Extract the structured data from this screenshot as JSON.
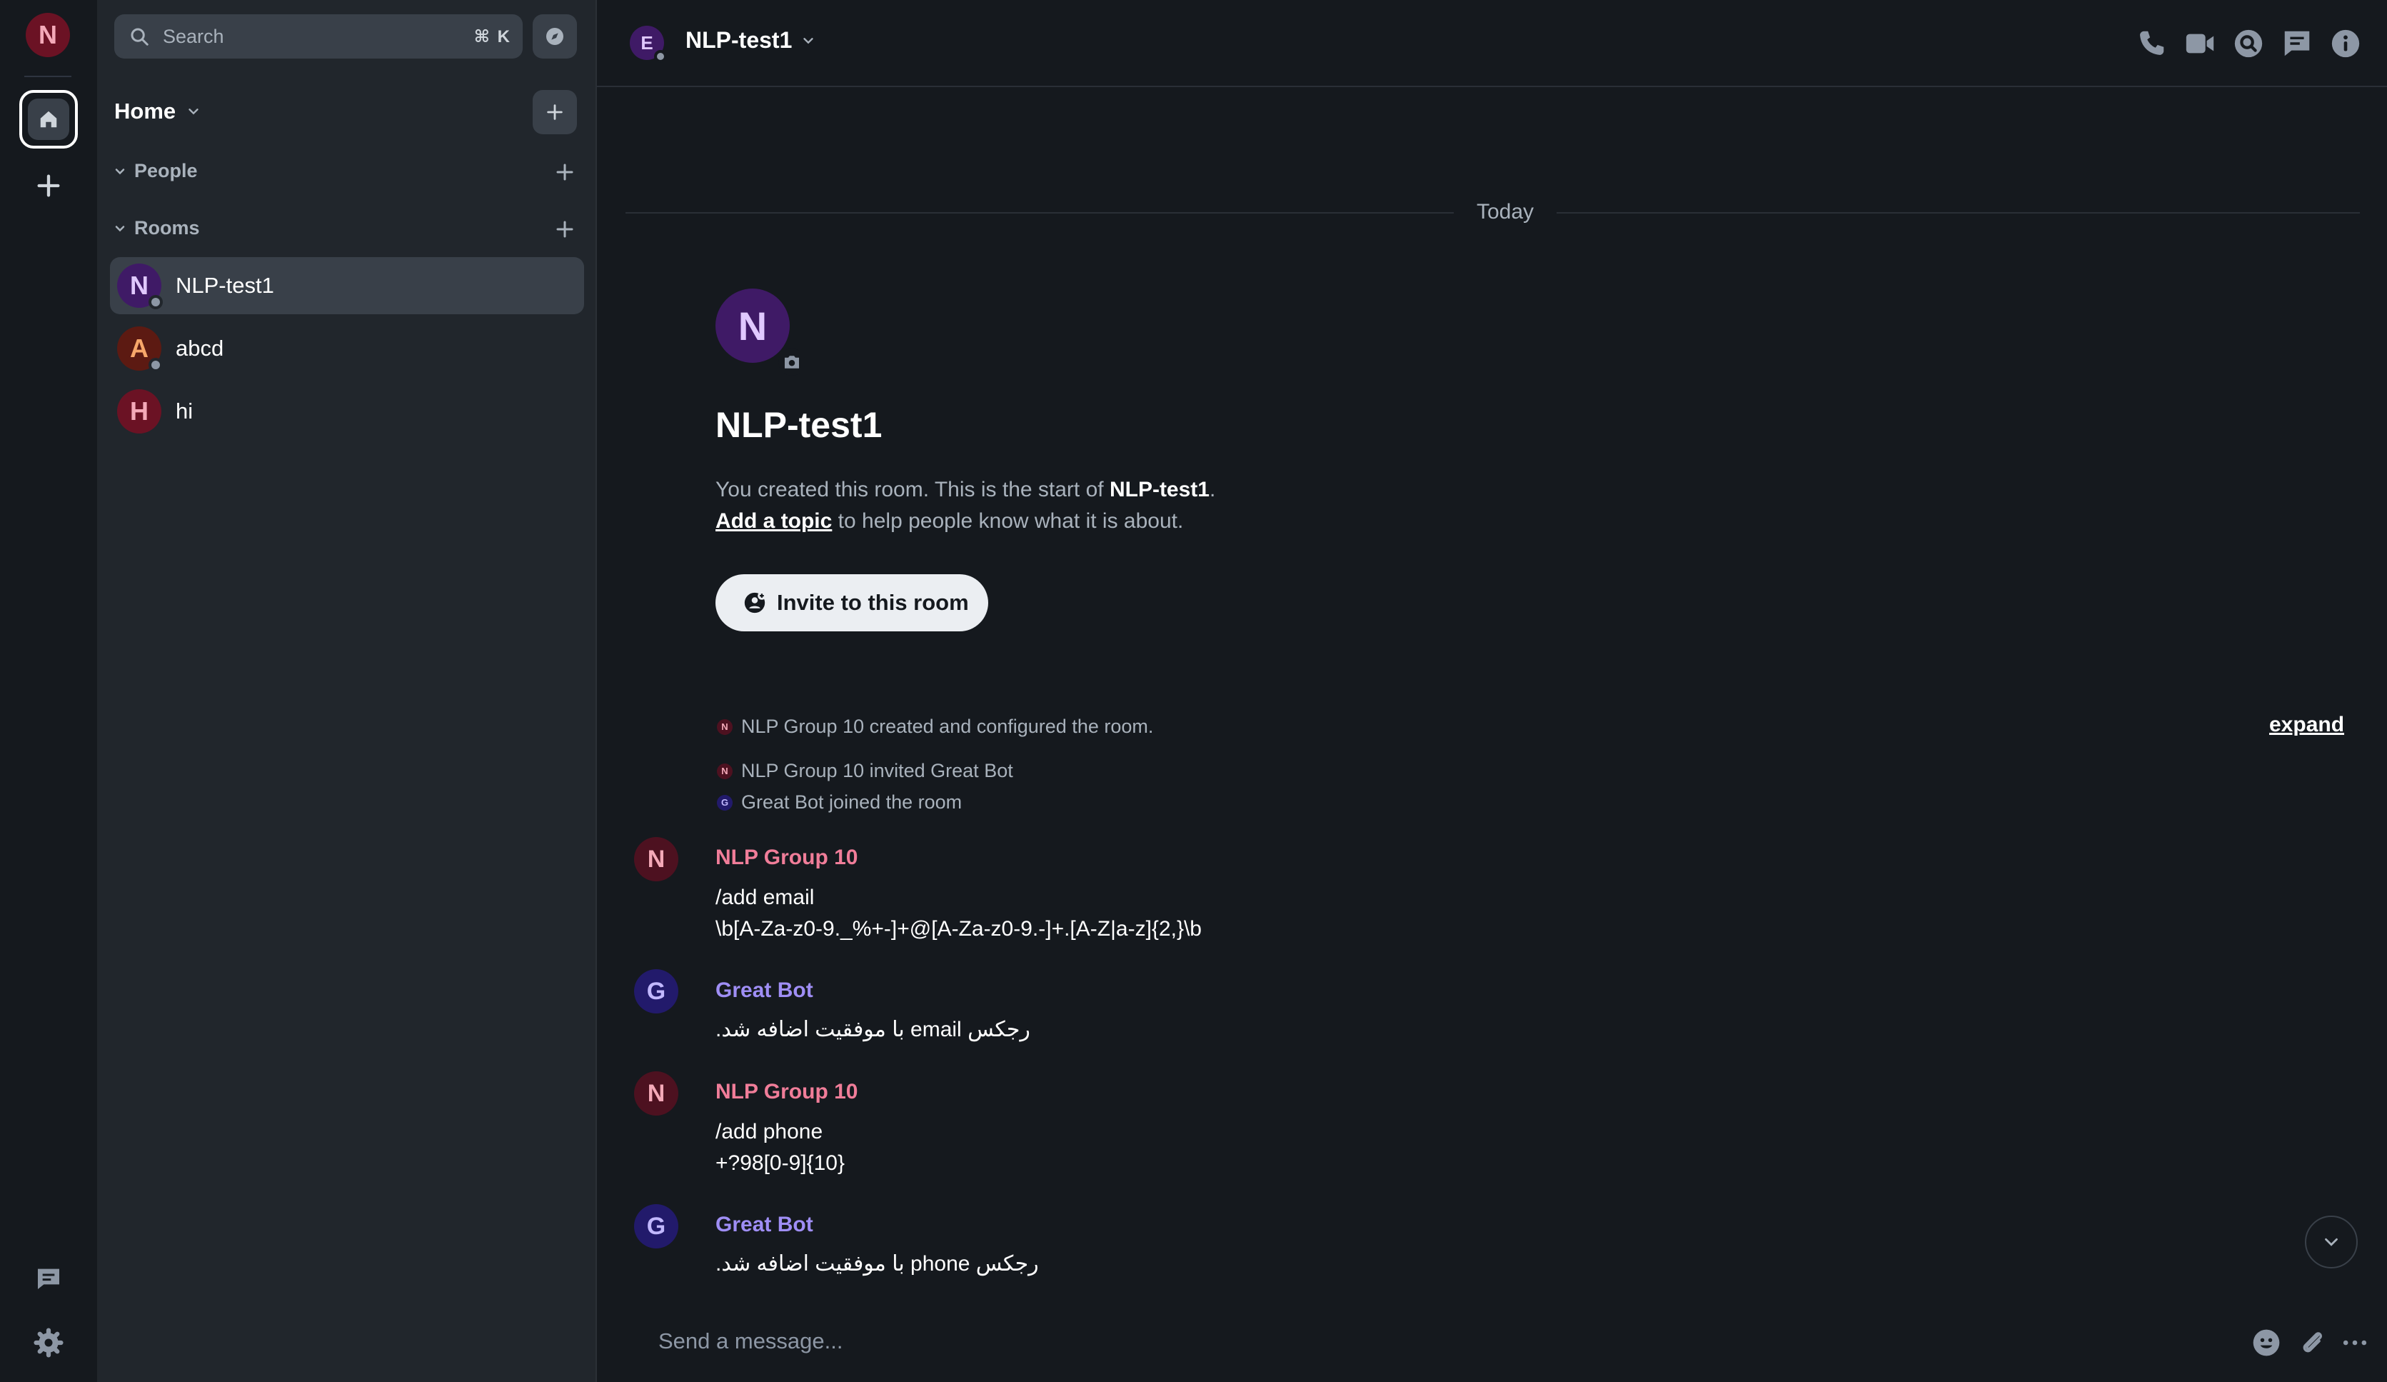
{
  "spacebar": {
    "user_initial": "N",
    "colors": {
      "avatar_bg": "#6b1224",
      "avatar_fg": "#f4a9b8"
    }
  },
  "roomlist": {
    "search": {
      "placeholder": "Search",
      "shortcut": "⌘ K"
    },
    "home": {
      "title": "Home"
    },
    "sections": [
      {
        "label": "People"
      },
      {
        "label": "Rooms"
      }
    ],
    "rooms": [
      {
        "name": "NLP-test1",
        "initial": "N",
        "active": true,
        "bg": "#3f1a66",
        "fg": "#e0c8ff"
      },
      {
        "name": "abcd",
        "initial": "A",
        "active": false,
        "bg": "#5c1a12",
        "fg": "#f7a76a"
      },
      {
        "name": "hi",
        "initial": "H",
        "active": false,
        "bg": "#6b1224",
        "fg": "#f4a9b8"
      }
    ]
  },
  "header": {
    "avatar_initial": "E",
    "room_name": "NLP-test1"
  },
  "timeline": {
    "date_separator": "Today",
    "intro": {
      "avatar_initial": "N",
      "room_name": "NLP-test1",
      "line1_prefix": "You created this room. This is the start of ",
      "line1_room": "NLP-test1",
      "line1_suffix": ".",
      "add_topic": "Add a topic",
      "line2_suffix": " to help people know what it is about.",
      "invite_button": "Invite to this room"
    },
    "events": [
      {
        "initial": "N",
        "text": "NLP Group 10 created and configured the room."
      },
      {
        "initial": "N",
        "text": "NLP Group 10 invited Great Bot"
      },
      {
        "initial": "G",
        "text": "Great Bot joined the room"
      }
    ],
    "expand_label": "expand",
    "messages": [
      {
        "initial": "N",
        "sender": "NLP Group 10",
        "lines": [
          "/add email",
          "\\b[A-Za-z0-9._%+-]+@[A-Za-z0-9.-]+.[A-Z|a-z]{2,}\\b"
        ]
      },
      {
        "initial": "G",
        "sender": "Great Bot",
        "lines": [
          "رجکس email با موفقیت اضافه شد."
        ]
      },
      {
        "initial": "N",
        "sender": "NLP Group 10",
        "lines": [
          "/add phone",
          "+?98[0-9]{10}"
        ]
      },
      {
        "initial": "G",
        "sender": "Great Bot",
        "lines": [
          "رجکس phone با موفقیت اضافه شد."
        ]
      }
    ],
    "colors": {
      "nlp_sender": "#f07d99",
      "bot_sender": "#9f8ef5",
      "nlp_avatar_bg": "#4d1120",
      "nlp_avatar_fg": "#f4a9b8",
      "bot_avatar_bg": "#221a6b",
      "bot_avatar_fg": "#c2b8ff"
    }
  },
  "composer": {
    "placeholder": "Send a message..."
  },
  "icons": [
    "home-icon",
    "plus-icon",
    "threads-icon",
    "settings-icon",
    "search-icon",
    "explore-icon",
    "chevron-down-icon",
    "voice-call-icon",
    "video-call-icon",
    "room-search-icon",
    "threads-icon",
    "room-info-icon",
    "camera-icon",
    "invite-user-icon",
    "emoji-icon",
    "attachment-icon",
    "more-options-icon"
  ]
}
